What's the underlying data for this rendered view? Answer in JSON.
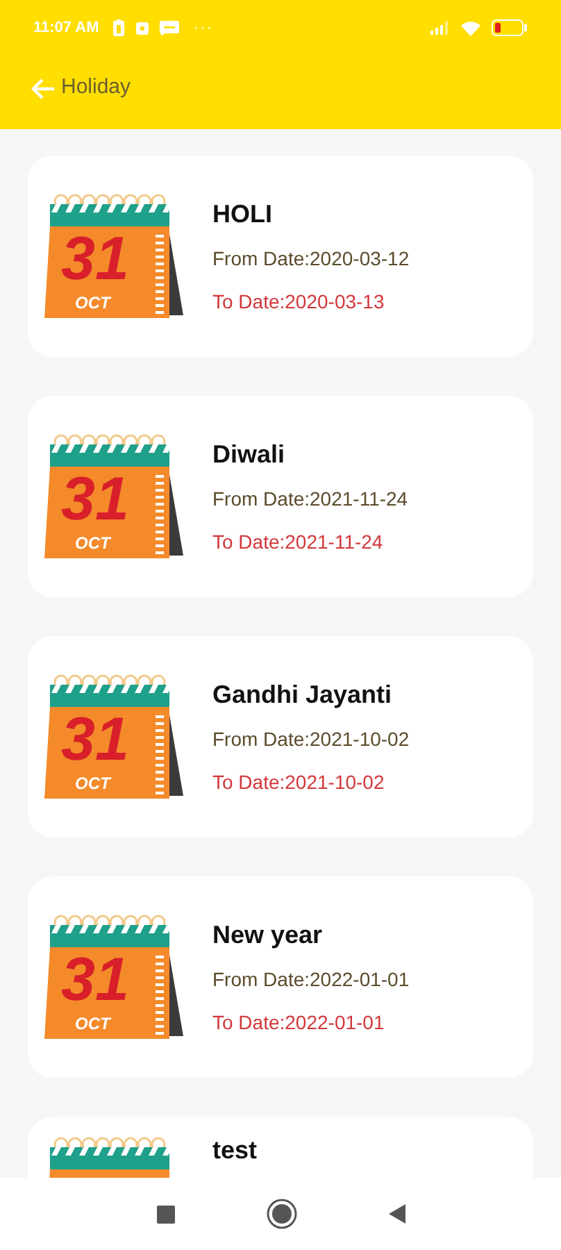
{
  "status_bar": {
    "time": "11:07 AM",
    "more": "···"
  },
  "app_bar": {
    "title": "Holiday"
  },
  "holidays": [
    {
      "title": "HOLI",
      "from_date": "From Date:2020-03-12",
      "to_date": "To Date:2020-03-13",
      "icon_day": "31",
      "icon_month": "OCT"
    },
    {
      "title": "Diwali",
      "from_date": "From Date:2021-11-24",
      "to_date": "To Date:2021-11-24",
      "icon_day": "31",
      "icon_month": "OCT"
    },
    {
      "title": "Gandhi Jayanti",
      "from_date": "From Date:2021-10-02",
      "to_date": "To Date:2021-10-02",
      "icon_day": "31",
      "icon_month": "OCT"
    },
    {
      "title": "New year",
      "from_date": "From Date:2022-01-01",
      "to_date": "To Date:2022-01-01",
      "icon_day": "31",
      "icon_month": "OCT"
    },
    {
      "title": "test"
    }
  ]
}
